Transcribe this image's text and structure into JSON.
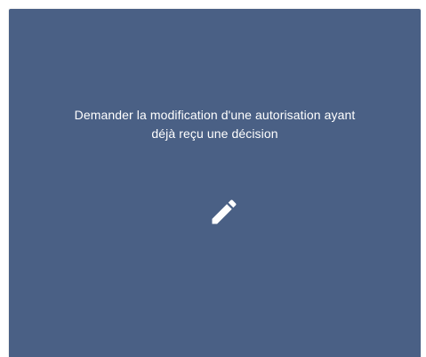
{
  "card": {
    "label_line1": "Demander la modification d'une autorisation ayant",
    "label_line2": "déjà reçu une décision",
    "icon": "pencil-icon",
    "background_color": "#4a6085",
    "text_color": "#ffffff"
  }
}
